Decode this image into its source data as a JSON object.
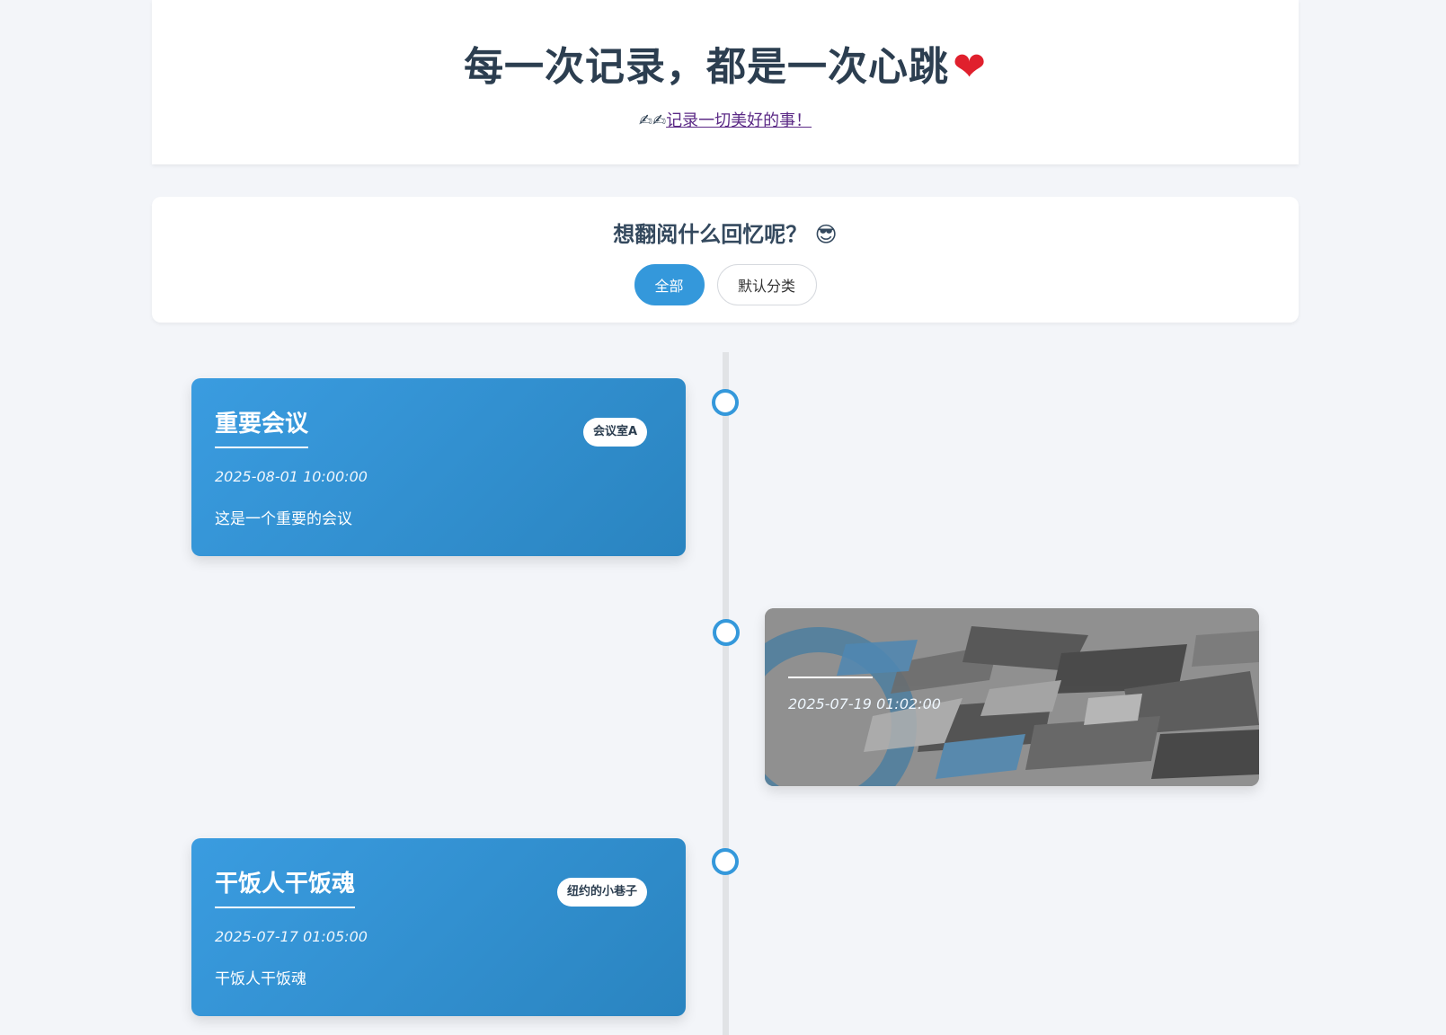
{
  "header": {
    "title": "每一次记录，都是一次心跳",
    "title_emoji": "❤",
    "subtitle_icons": "✍✍",
    "subtitle_link": "记录一切美好的事！"
  },
  "filter": {
    "heading": "想翻阅什么回忆呢？",
    "heading_emoji": "😎",
    "buttons": [
      {
        "label": "全部",
        "active": true
      },
      {
        "label": "默认分类",
        "active": false
      }
    ]
  },
  "timeline": [
    {
      "title": "重要会议",
      "tag": "会议室A",
      "date": "2025-08-01 10:00:00",
      "desc": "这是一个重要的会议",
      "side": "left"
    },
    {
      "title": "",
      "tag": "",
      "date": "2025-07-19 01:02:00",
      "desc": "",
      "side": "right",
      "image_card": true
    },
    {
      "title": "干饭人干饭魂",
      "tag": "纽约的小巷子",
      "date": "2025-07-17 01:05:00",
      "desc": "干饭人干饭魂",
      "side": "left"
    }
  ],
  "colors": {
    "accent": "#3498db",
    "card_gradient_start": "#3a9ce0",
    "card_gradient_end": "#2a84c0",
    "page_bg": "#f3f5f9",
    "heart": "#e0202d"
  }
}
